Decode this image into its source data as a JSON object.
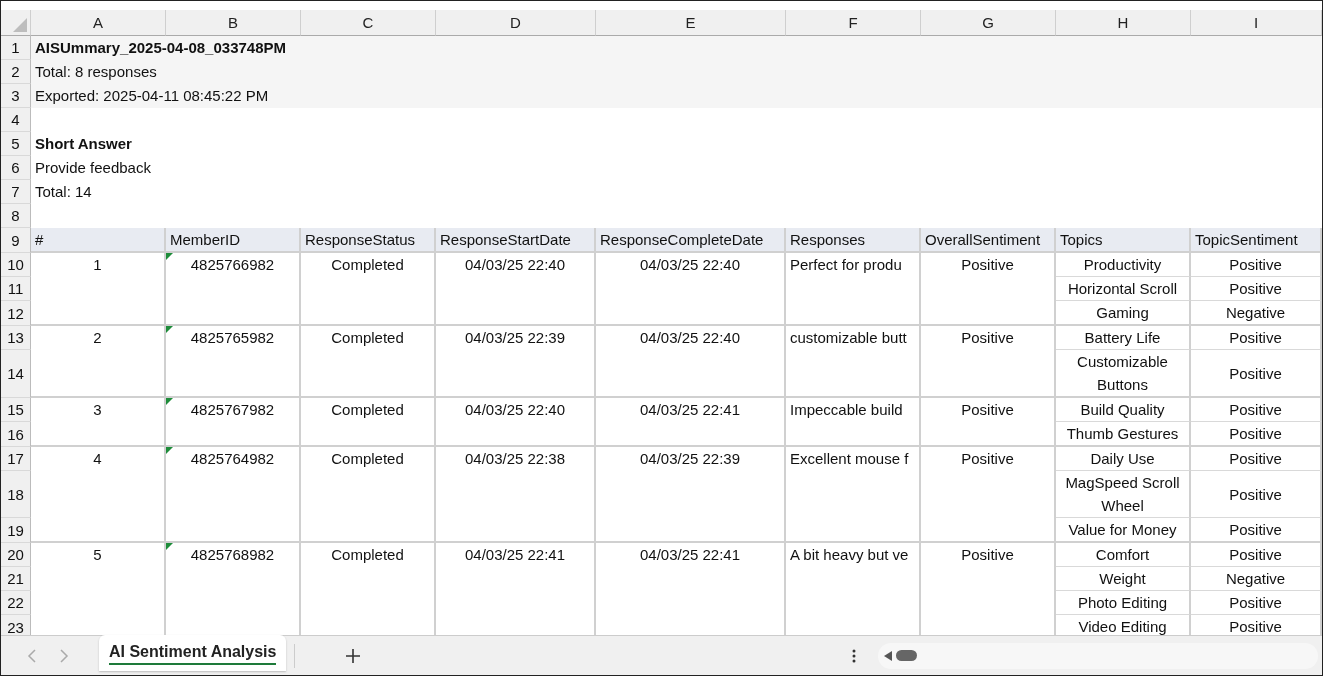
{
  "column_headers": [
    "A",
    "B",
    "C",
    "D",
    "E",
    "F",
    "G",
    "H",
    "I"
  ],
  "row_numbers": [
    "1",
    "2",
    "3",
    "4",
    "5",
    "6",
    "7",
    "8",
    "9",
    "10",
    "11",
    "12",
    "13",
    "14",
    "15",
    "16",
    "17",
    "18",
    "19",
    "20",
    "21",
    "22",
    "23"
  ],
  "summary": [
    {
      "kind": "title",
      "text": "AISUmmary_2025-04-08_033748PM"
    },
    {
      "kind": "line",
      "text": "Total: 8 responses"
    },
    {
      "kind": "line",
      "text": "Exported: 2025-04-11 08:45:22 PM"
    }
  ],
  "section": [
    {
      "kind": "title",
      "text": "Short Answer"
    },
    {
      "kind": "line",
      "text": "Provide feedback"
    },
    {
      "kind": "line",
      "text": "Total: 14"
    }
  ],
  "table": {
    "columns": [
      "#",
      "MemberID",
      "ResponseStatus",
      "ResponseStartDate",
      "ResponseCompleteDate",
      "Responses",
      "OverallSentiment",
      "Topics",
      "TopicSentiment"
    ],
    "rows": [
      {
        "number": "1",
        "member_id": "4825766982",
        "flagged": true,
        "status": "Completed",
        "start": "04/03/25 22:40",
        "complete": "04/03/25 22:40",
        "response": "Perfect for produ",
        "overall": "Positive",
        "topics": [
          {
            "topic": "Productivity",
            "sentiment": "Positive"
          },
          {
            "topic": "Horizontal Scroll",
            "sentiment": "Positive"
          },
          {
            "topic": "Gaming",
            "sentiment": "Negative"
          }
        ]
      },
      {
        "number": "2",
        "member_id": "4825765982",
        "flagged": true,
        "status": "Completed",
        "start": "04/03/25 22:39",
        "complete": "04/03/25 22:40",
        "response": "customizable butt",
        "overall": "Positive",
        "topics": [
          {
            "topic": "Battery Life",
            "sentiment": "Positive"
          },
          {
            "topic": "Customizable Buttons",
            "sentiment": "Positive"
          }
        ]
      },
      {
        "number": "3",
        "member_id": "4825767982",
        "flagged": true,
        "status": "Completed",
        "start": "04/03/25 22:40",
        "complete": "04/03/25 22:41",
        "response": "Impeccable build",
        "overall": "Positive",
        "topics": [
          {
            "topic": "Build Quality",
            "sentiment": "Positive"
          },
          {
            "topic": "Thumb Gestures",
            "sentiment": "Positive"
          }
        ]
      },
      {
        "number": "4",
        "member_id": "4825764982",
        "flagged": true,
        "status": "Completed",
        "start": "04/03/25 22:38",
        "complete": "04/03/25 22:39",
        "response": "Excellent mouse f",
        "overall": "Positive",
        "topics": [
          {
            "topic": "Daily Use",
            "sentiment": "Positive"
          },
          {
            "topic": "MagSpeed Scroll Wheel",
            "sentiment": "Positive"
          },
          {
            "topic": "Value for Money",
            "sentiment": "Positive"
          }
        ]
      },
      {
        "number": "5",
        "member_id": "4825768982",
        "flagged": true,
        "status": "Completed",
        "start": "04/03/25 22:41",
        "complete": "04/03/25 22:41",
        "response": "A bit heavy but ve",
        "overall": "Positive",
        "topics": [
          {
            "topic": "Comfort",
            "sentiment": "Positive"
          },
          {
            "topic": "Weight",
            "sentiment": "Negative"
          },
          {
            "topic": "Photo Editing",
            "sentiment": "Positive"
          },
          {
            "topic": "Video Editing",
            "sentiment": "Positive"
          }
        ]
      }
    ]
  },
  "sheet_tabs": [
    {
      "label": "AI Sentiment Analysis",
      "selected": true
    }
  ]
}
